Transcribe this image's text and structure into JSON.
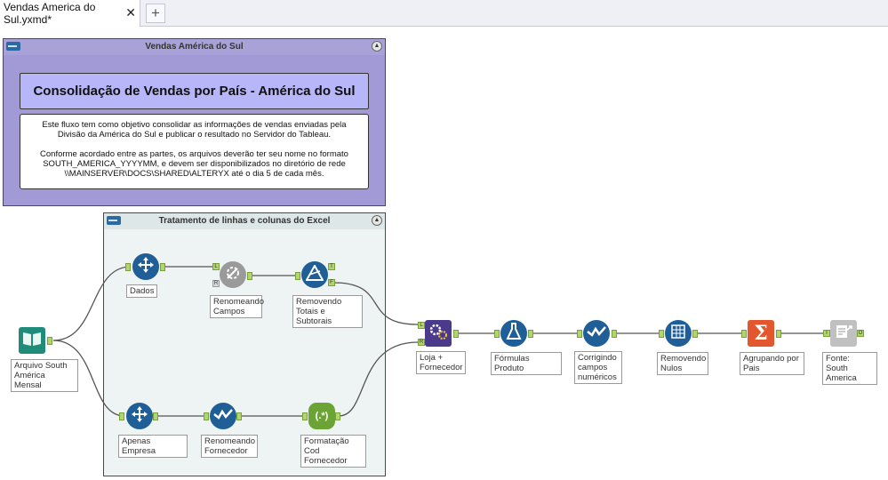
{
  "tabs": [
    {
      "label": "Vendas America do Sul.yxmd*",
      "close": "✕"
    }
  ],
  "new_tab": "+",
  "containers": {
    "sul": {
      "title": "Vendas América do Sul",
      "heading": "Consolidação de Vendas por País - América do Sul",
      "desc1": "Este fluxo tem como objetivo consolidar as informações de vendas enviadas pela Divisão da América do Sul e publicar o resultado no Servidor do Tableau.",
      "desc2": "Conforme acordado entre as partes, os arquivos deverão ter seu nome no formato SOUTH_AMERICA_YYYYMM, e devem ser disponibilizados no diretório de rede \\\\MAINSERVER\\DOCS\\SHARED\\ALTERYX até o dia 5 de cada mês."
    },
    "excel": {
      "title": "Tratamento de linhas e colunas do Excel"
    }
  },
  "collapse_glyph": "▲",
  "anchors": {
    "L": "L",
    "R": "R",
    "T": "T",
    "F": "F",
    "I": "I",
    "O": "O"
  },
  "tools": {
    "input": {
      "label": "Arquivo South América Mensal",
      "icon": "book-icon"
    },
    "dados": {
      "label": "Dados",
      "icon": "select-arrows-icon"
    },
    "renome": {
      "label": "Renomeando Campos",
      "icon": "gear-pencil-icon"
    },
    "remtot": {
      "label": "Removendo Totais e Subtorais",
      "icon": "filter-triangle-icon"
    },
    "apenas": {
      "label": "Apenas Empresa",
      "icon": "select-arrows-icon"
    },
    "renforn": {
      "label": "Renomeando Fornecedor",
      "icon": "check-wave-icon"
    },
    "formcod": {
      "label": "Formatação Cod Fornecedor",
      "icon": "regex-icon",
      "glyph": "(.*)"
    },
    "loja": {
      "label": "Loja + Fornecedor",
      "icon": "join-gears-icon"
    },
    "formulas": {
      "label": "Fórmulas Produto",
      "icon": "flask-icon"
    },
    "corrig": {
      "label": "Corrigindo campos numéricos",
      "icon": "check-wave-icon"
    },
    "remnul": {
      "label": "Removendo Nulos",
      "icon": "data-cleanse-icon"
    },
    "agrup": {
      "label": "Agrupando por Pais",
      "icon": "sigma-icon",
      "glyph": "Σ"
    },
    "fonte": {
      "label": "Fonte: South America",
      "icon": "publish-tableau-icon"
    }
  }
}
